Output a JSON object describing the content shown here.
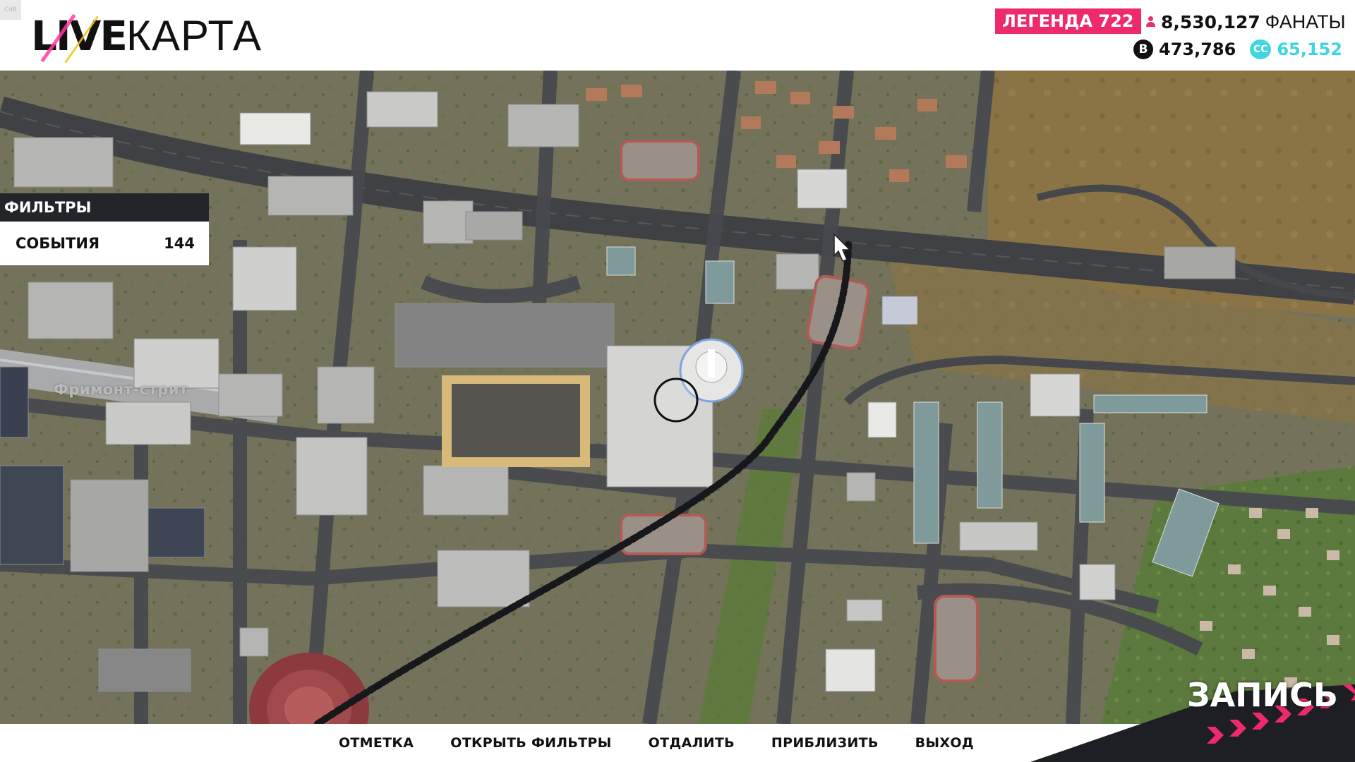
{
  "corner_tag": "Cd8",
  "logo": {
    "part1": "LIVE",
    "part2": "КАРТА"
  },
  "header": {
    "legend_label": "ЛЕГЕНДА 722",
    "fans_count": "8,530,127",
    "fans_label": "ФАНАТЫ",
    "coins_b": "473,786",
    "coins_c": "65,152",
    "coin_b_symbol": "B",
    "coin_c_symbol": "CC"
  },
  "filters": {
    "title": "ФИЛЬТРЫ",
    "items": [
      {
        "label": "СОБЫТИЯ",
        "count": "144"
      }
    ]
  },
  "map": {
    "street_label": "Фримонт-стрит"
  },
  "record_label": "ЗАПИСЬ",
  "actions": [
    "ОТМЕТКА",
    "ОТКРЫТЬ ФИЛЬТРЫ",
    "ОТДАЛИТЬ",
    "ПРИБЛИЗИТЬ",
    "ВЫХОД"
  ],
  "colors": {
    "accent_pink": "#ee2a6c",
    "accent_cyan": "#3fd5e0",
    "panel_dark": "#222529"
  },
  "icons": {
    "fans": "fans-icon",
    "coin_b": "b-coin-icon",
    "coin_c": "cc-coin-icon",
    "cursor": "map-cursor-icon",
    "location": "location-ring-icon"
  }
}
